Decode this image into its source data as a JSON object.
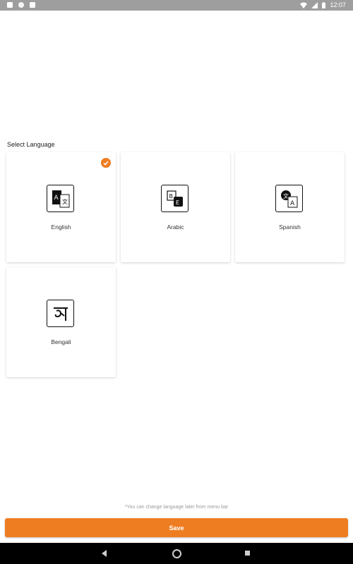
{
  "status_bar": {
    "time": "12:07",
    "icons": [
      "photo-icon",
      "circle-icon",
      "sd-card-icon",
      "wifi-icon",
      "signal-icon",
      "battery-icon"
    ]
  },
  "main": {
    "section_title": "Select Language",
    "languages": [
      {
        "label": "English",
        "icon": "translate-icon",
        "selected": true
      },
      {
        "label": "Arabic",
        "icon": "translate-icon",
        "selected": false
      },
      {
        "label": "Spanish",
        "icon": "translate-icon",
        "selected": false
      },
      {
        "label": "Bengali",
        "icon": "bengali-letter-icon",
        "selected": false
      }
    ],
    "note": "*You can change language later from menu bar",
    "save_label": "Save"
  },
  "colors": {
    "accent": "#ee7d22",
    "status_bar": "#9e9e9e",
    "nav_bar": "#000000"
  },
  "nav_bar": {
    "icons": [
      "back-icon",
      "home-icon",
      "recents-icon"
    ]
  }
}
